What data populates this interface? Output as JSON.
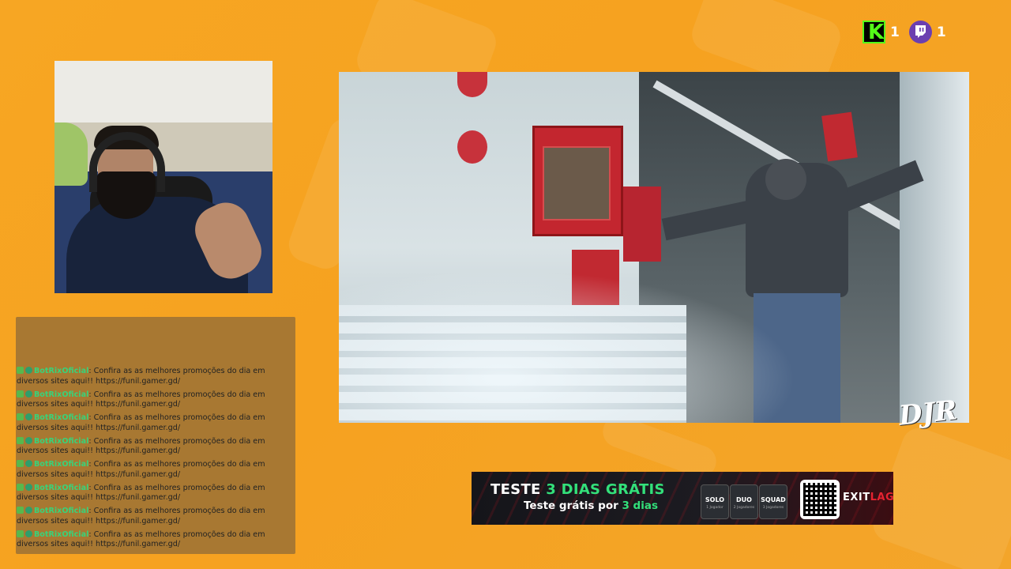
{
  "viewer_counts": {
    "kick": {
      "icon": "kick-icon",
      "value": "1",
      "color": "#53fc18"
    },
    "twitch": {
      "icon": "twitch-icon",
      "value": "1",
      "color": "#6b3fb0"
    }
  },
  "chat": {
    "messages": [
      {
        "user": "BotRixOficial",
        "text": ": Confira as as melhores promoções do dia em diversos sites aqui!! https://funil.gamer.gd/"
      },
      {
        "user": "BotRixOficial",
        "text": ": Confira as as melhores promoções do dia em diversos sites aqui!! https://funil.gamer.gd/"
      },
      {
        "user": "BotRixOficial",
        "text": ": Confira as as melhores promoções do dia em diversos sites aqui!! https://funil.gamer.gd/"
      },
      {
        "user": "BotRixOficial",
        "text": ": Confira as as melhores promoções do dia em diversos sites aqui!! https://funil.gamer.gd/"
      },
      {
        "user": "BotRixOficial",
        "text": ": Confira as as melhores promoções do dia em diversos sites aqui!! https://funil.gamer.gd/"
      },
      {
        "user": "BotRixOficial",
        "text": ": Confira as as melhores promoções do dia em diversos sites aqui!! https://funil.gamer.gd/"
      },
      {
        "user": "BotRixOficial",
        "text": ": Confira as as melhores promoções do dia em diversos sites aqui!! https://funil.gamer.gd/"
      },
      {
        "user": "BotRixOficial",
        "text": ": Confira as as melhores promoções do dia em diversos sites aqui!! https://funil.gamer.gd/"
      }
    ],
    "badge_colors": {
      "pencil": "#58b84c",
      "bot": "#2e9e6b",
      "username": "#38d37a"
    }
  },
  "watermark": "DJR",
  "ad": {
    "title_prefix": "TESTE ",
    "title_highlight": "3 DIAS GRÁTIS",
    "subtitle_prefix": "Teste grátis por ",
    "subtitle_highlight": "3 dias",
    "plans": [
      {
        "name": "SOLO",
        "detail": "1 Jogador"
      },
      {
        "name": "DUO",
        "detail": "2 Jogadores"
      },
      {
        "name": "SQUAD",
        "detail": "3 Jogadores"
      }
    ],
    "brand_prefix": "EXIT",
    "brand_suffix": "LAG",
    "accent_color": "#33e07a"
  },
  "colors": {
    "background": "#f7a623",
    "chat_panel": "#a87832"
  }
}
